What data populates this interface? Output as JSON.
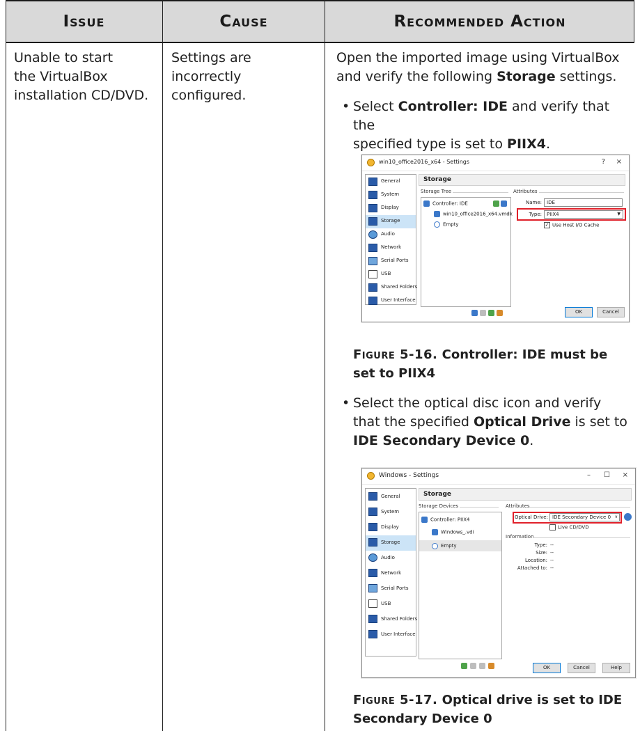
{
  "table": {
    "headers": [
      "Issue",
      "Cause",
      "Recommended Action"
    ],
    "issue": "Unable to start the VirtualBox installation CD/DVD.",
    "issue_lines": [
      "Unable to start",
      "the VirtualBox",
      "installation CD/DVD."
    ],
    "cause_lines": [
      "Settings are",
      "incorrectly",
      "configured."
    ],
    "action_intro_lines": [
      "Open the imported image using VirtualBox",
      "and verify the following "
    ],
    "action_intro_bold": "Storage",
    "action_intro_tail": " settings.",
    "bullet1": {
      "line1_pre": "Select ",
      "line1_bold": "Controller: IDE",
      "line1_post": " and verify that the",
      "line2_pre": "specified type is set to ",
      "line2_bold": "PIIX4",
      "line2_post": "."
    },
    "caption1": {
      "fig": "Figure 5-16.",
      "text1": " Controller: IDE must be",
      "text2": "set to PIIX4"
    },
    "bullet2": {
      "line1": "Select the optical disc icon and verify",
      "line2_pre": "that the specified ",
      "line2_bold": "Optical Drive",
      "line2_post": " is set to",
      "line3_bold": "IDE Secondary Device 0",
      "line3_post": "."
    },
    "caption2": {
      "fig": "Figure 5-17.",
      "text1": " Optical drive is set to IDE",
      "text2": "Secondary Device 0"
    }
  },
  "screenshot1": {
    "title": "win10_office2016_x64 - Settings",
    "title_buttons": [
      "?",
      "×"
    ],
    "sidebar": [
      "General",
      "System",
      "Display",
      "Storage",
      "Audio",
      "Network",
      "Serial Ports",
      "USB",
      "Shared Folders",
      "User Interface"
    ],
    "selected": "Storage",
    "panel_title": "Storage",
    "tree_label": "Storage Tree",
    "attr_label": "Attributes",
    "tree": [
      "Controller: IDE",
      "win10_office2016_x64.vmdk",
      "Empty"
    ],
    "name_label": "Name:",
    "name_value": "IDE",
    "type_label": "Type:",
    "type_value": "PIIX4",
    "cache_label": "Use Host I/O Cache",
    "ok": "OK",
    "cancel": "Cancel"
  },
  "screenshot2": {
    "title": "Windows - Settings",
    "title_buttons": [
      "–",
      "☐",
      "×"
    ],
    "sidebar": [
      "General",
      "System",
      "Display",
      "Storage",
      "Audio",
      "Network",
      "Serial Ports",
      "USB",
      "Shared Folders",
      "User Interface"
    ],
    "selected": "Storage",
    "panel_title": "Storage",
    "tree_label": "Storage Devices",
    "attr_label": "Attributes",
    "tree": [
      "Controller: PIIX4",
      "Windows_.vdi",
      "Empty"
    ],
    "optical_label": "Optical Drive:",
    "optical_value": "IDE Secondary Device 0",
    "live_label": "Live CD/DVD",
    "info_label": "Information",
    "info_rows": [
      {
        "k": "Type:",
        "v": "--"
      },
      {
        "k": "Size:",
        "v": "--"
      },
      {
        "k": "Location:",
        "v": "--"
      },
      {
        "k": "Attached to:",
        "v": "--"
      }
    ],
    "ok": "OK",
    "cancel": "Cancel",
    "help": "Help"
  },
  "colors": {
    "header_bg": "#d9d9d9",
    "highlight_red": "#e0202a",
    "selection_blue": "#cce4f7"
  }
}
